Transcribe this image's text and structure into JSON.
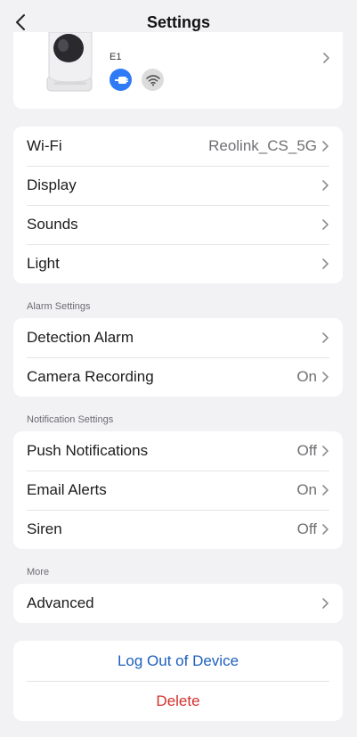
{
  "header": {
    "title": "Settings"
  },
  "device": {
    "name": "E1",
    "icons": [
      "power-plug-icon",
      "wifi-icon"
    ]
  },
  "general": {
    "items": [
      {
        "label": "Wi-Fi",
        "value": "Reolink_CS_5G"
      },
      {
        "label": "Display",
        "value": ""
      },
      {
        "label": "Sounds",
        "value": ""
      },
      {
        "label": "Light",
        "value": ""
      }
    ]
  },
  "alarm": {
    "title": "Alarm Settings",
    "items": [
      {
        "label": "Detection Alarm",
        "value": ""
      },
      {
        "label": "Camera Recording",
        "value": "On"
      }
    ]
  },
  "notification": {
    "title": "Notification Settings",
    "items": [
      {
        "label": "Push Notifications",
        "value": "Off"
      },
      {
        "label": "Email Alerts",
        "value": "On"
      },
      {
        "label": "Siren",
        "value": "Off"
      }
    ]
  },
  "more": {
    "title": "More",
    "items": [
      {
        "label": "Advanced",
        "value": ""
      }
    ]
  },
  "actions": {
    "logout": "Log Out of Device",
    "delete": "Delete"
  },
  "colors": {
    "accent": "#2f7bf5",
    "link": "#1c5fbf",
    "danger": "#d2312c",
    "background": "#f2f2f4"
  }
}
